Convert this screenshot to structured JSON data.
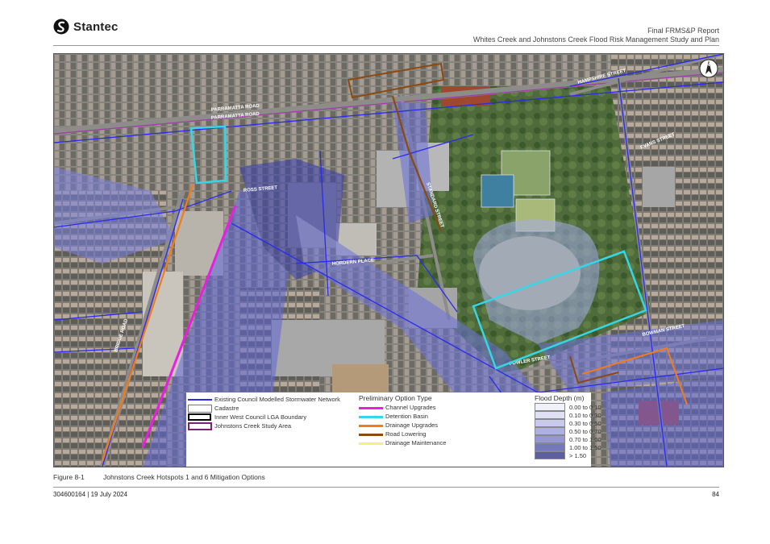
{
  "header": {
    "company": "Stantec",
    "report_title": "Final FRMS&P Report",
    "report_subtitle": "Whites Creek and Johnstons Creek Flood Risk Management Study and Plan"
  },
  "map": {
    "street_labels": [
      {
        "text": "PARRAMATTA ROAD",
        "color": "#ffffff"
      },
      {
        "text": "PARRAMATTA ROAD",
        "color": "#ffffff"
      },
      {
        "text": "BRIDGE ROAD",
        "color": "#ffffff"
      },
      {
        "text": "ROSS STREET",
        "color": "#ffffff"
      },
      {
        "text": "HORDERN PLACE",
        "color": "#ffffff"
      },
      {
        "text": "HAMPSHIRE STREET",
        "color": "#ffffff"
      },
      {
        "text": "FOWLER STREET",
        "color": "#ffffff"
      },
      {
        "text": "EVANS STREET",
        "color": "#ffffff"
      },
      {
        "text": "BOWMAN STREET",
        "color": "#ffffff"
      },
      {
        "text": "STANDARD STREET",
        "color": "#ffffff"
      }
    ]
  },
  "legend": {
    "network_items": [
      {
        "label": "Existing Council Modelled Stormwater Network",
        "color": "#2a2af0",
        "style": "line"
      },
      {
        "label": "Cadastre",
        "color": "#ffffff",
        "style": "box"
      },
      {
        "label": "Inner West Council LGA Boundary",
        "color": "#000000",
        "style": "thick-box"
      },
      {
        "label": "Johnstons Creek Study Area",
        "color": "#7a1f7a",
        "style": "box"
      }
    ],
    "option_title": "Preliminary Option Type",
    "option_items": [
      {
        "label": "Channel Upgrades",
        "color": "#e91ee3"
      },
      {
        "label": "Detention Basin",
        "color": "#35d7e6"
      },
      {
        "label": "Drainage Upgrades",
        "color": "#f07c1a"
      },
      {
        "label": "Road Lowering",
        "color": "#8a4a10"
      },
      {
        "label": "Drainage Maintenance",
        "color": "#f4f07a"
      }
    ],
    "depth_title": "Flood Depth (m)",
    "depth_items": [
      {
        "label": "0.00 to 0.10",
        "color": "#f1f1fa"
      },
      {
        "label": "0.10 to 0.30",
        "color": "#e0e0f4"
      },
      {
        "label": "0.30 to 0.50",
        "color": "#c8c9ec"
      },
      {
        "label": "0.50 to 0.70",
        "color": "#aeb0e1"
      },
      {
        "label": "0.70 to 1.00",
        "color": "#9497d3"
      },
      {
        "label": "1.00 to 1.50",
        "color": "#7478bd"
      },
      {
        "label": "> 1.50",
        "color": "#5d5f9f"
      }
    ]
  },
  "caption": {
    "label": "Figure 8-1",
    "text": "Johnstons Creek Hotspots 1 and 6 Mitigation Options"
  },
  "footer": {
    "document_ref": "304600164 | 19 July 2024",
    "page_number": "84"
  }
}
